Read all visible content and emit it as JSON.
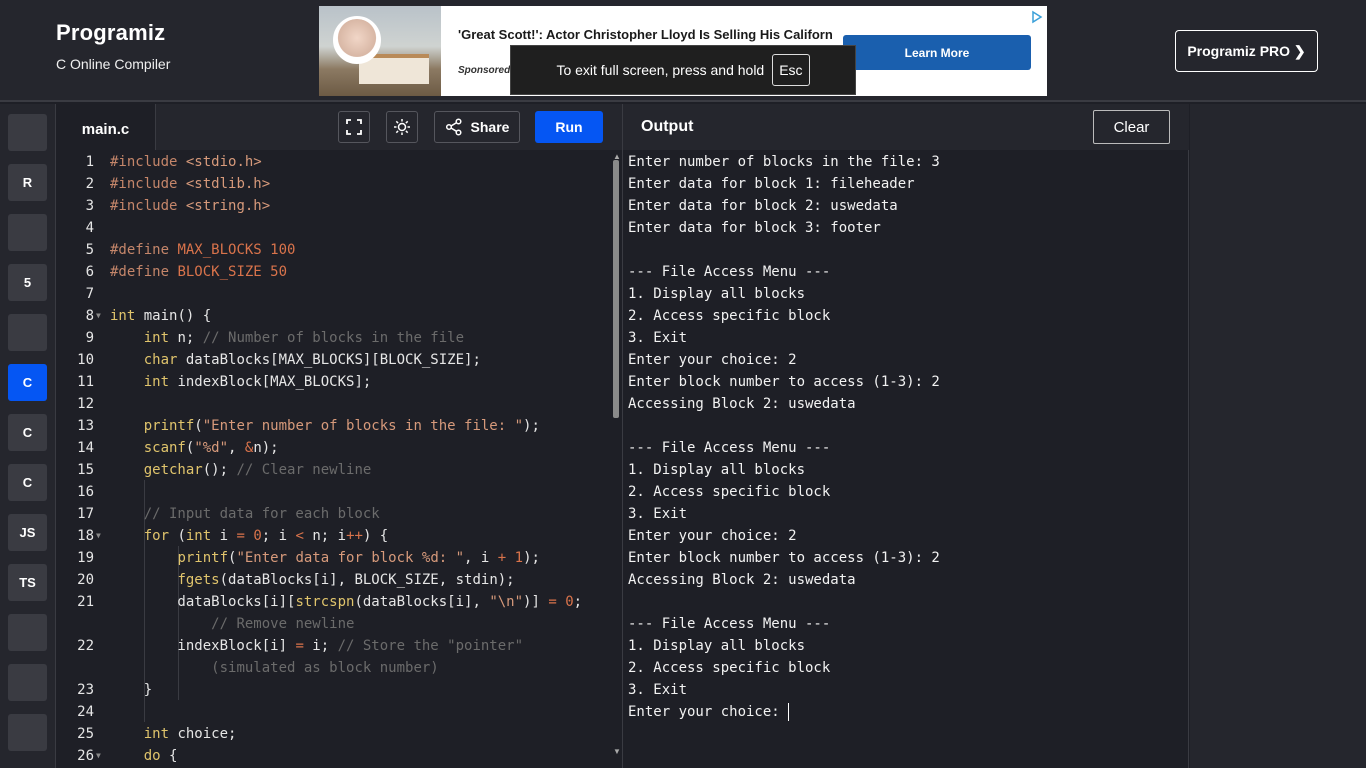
{
  "brand": {
    "name": "Programiz",
    "subtitle": "C Online Compiler",
    "pro_label": "Programiz PRO ❯"
  },
  "ad": {
    "title": "'Great Scott!': Actor Christopher Lloyd Is Selling His Californ",
    "sponsored": "Sponsored",
    "cta": "Learn More"
  },
  "fullscreen_toast": {
    "text": "To exit full screen, press and hold",
    "key": "Esc"
  },
  "languages": [
    {
      "name": "python-icon",
      "label": ""
    },
    {
      "name": "r-icon",
      "label": "R"
    },
    {
      "name": "sql-icon",
      "label": ""
    },
    {
      "name": "html-icon",
      "label": "5"
    },
    {
      "name": "java-icon",
      "label": ""
    },
    {
      "name": "c-icon",
      "label": "C"
    },
    {
      "name": "cpp-icon",
      "label": "C"
    },
    {
      "name": "csharp-icon",
      "label": "C"
    },
    {
      "name": "js-icon",
      "label": "JS"
    },
    {
      "name": "ts-icon",
      "label": "TS"
    },
    {
      "name": "go-icon",
      "label": ""
    },
    {
      "name": "php-icon",
      "label": ""
    },
    {
      "name": "swift-icon",
      "label": ""
    }
  ],
  "editor": {
    "tab": "main.c",
    "share_label": "Share",
    "run_label": "Run",
    "lines": [
      {
        "n": "1",
        "html": "<span class=\"pp\">#include</span> <span class=\"str\">&lt;stdio.h&gt;</span>"
      },
      {
        "n": "2",
        "html": "<span class=\"pp\">#include</span> <span class=\"str\">&lt;stdlib.h&gt;</span>"
      },
      {
        "n": "3",
        "html": "<span class=\"pp\">#include</span> <span class=\"str\">&lt;string.h&gt;</span>"
      },
      {
        "n": "4",
        "html": ""
      },
      {
        "n": "5",
        "html": "<span class=\"pp\">#define</span> <span class=\"num\">MAX_BLOCKS 100</span>"
      },
      {
        "n": "6",
        "html": "<span class=\"pp\">#define</span> <span class=\"num\">BLOCK_SIZE 50</span>"
      },
      {
        "n": "7",
        "html": ""
      },
      {
        "n": "8",
        "fold": true,
        "html": "<span class=\"kw\">int</span> main() {"
      },
      {
        "n": "9",
        "html": "    <span class=\"kw\">int</span> n; <span class=\"com\">// Number of blocks in the file</span>"
      },
      {
        "n": "10",
        "html": "    <span class=\"kw\">char</span> dataBlocks[MAX_BLOCKS][BLOCK_SIZE];"
      },
      {
        "n": "11",
        "html": "    <span class=\"kw\">int</span> indexBlock[MAX_BLOCKS];"
      },
      {
        "n": "12",
        "html": ""
      },
      {
        "n": "13",
        "html": "    <span class=\"fn\">printf</span>(<span class=\"str\">\"Enter number of blocks in the file: \"</span>);"
      },
      {
        "n": "14",
        "html": "    <span class=\"fn\">scanf</span>(<span class=\"str\">\"%d\"</span>, <span class=\"num\">&amp;</span>n);"
      },
      {
        "n": "15",
        "html": "    <span class=\"fn\">getchar</span>(); <span class=\"com\">// Clear newline</span>"
      },
      {
        "n": "16",
        "html": ""
      },
      {
        "n": "17",
        "html": "    <span class=\"com\">// Input data for each block</span>"
      },
      {
        "n": "18",
        "fold": true,
        "html": "    <span class=\"kw\">for</span> (<span class=\"kw\">int</span> i <span class=\"num\">=</span> <span class=\"num\">0</span>; i <span class=\"num\">&lt;</span> n; i<span class=\"num\">++</span>) {"
      },
      {
        "n": "19",
        "html": "        <span class=\"fn\">printf</span>(<span class=\"str\">\"Enter data for block %d: \"</span>, i <span class=\"num\">+</span> <span class=\"num\">1</span>);"
      },
      {
        "n": "20",
        "html": "        <span class=\"fn\">fgets</span>(dataBlocks[i], BLOCK_SIZE, stdin);"
      },
      {
        "n": "21",
        "html": "        dataBlocks[i][<span class=\"fn\">strcspn</span>(dataBlocks[i], <span class=\"str\">\"\\n\"</span>)] <span class=\"num\">=</span> <span class=\"num\">0</span>;"
      },
      {
        "n": "",
        "html": "            <span class=\"com\">// Remove newline</span>"
      },
      {
        "n": "22",
        "html": "        indexBlock[i] <span class=\"num\">=</span> i; <span class=\"com\">// Store the \"pointer\"</span>"
      },
      {
        "n": "",
        "html": "            <span class=\"com\">(simulated as block number)</span>"
      },
      {
        "n": "23",
        "html": "    }"
      },
      {
        "n": "24",
        "html": ""
      },
      {
        "n": "25",
        "html": "    <span class=\"kw\">int</span> choice;"
      },
      {
        "n": "26",
        "fold": true,
        "html": "    <span class=\"kw\">do</span> {"
      }
    ]
  },
  "output": {
    "title": "Output",
    "clear_label": "Clear",
    "lines": [
      "Enter number of blocks in the file: 3",
      "Enter data for block 1: fileheader",
      "Enter data for block 2: uswedata",
      "Enter data for block 3: footer",
      "",
      "--- File Access Menu ---",
      "1. Display all blocks",
      "2. Access specific block",
      "3. Exit",
      "Enter your choice: 2",
      "Enter block number to access (1-3): 2",
      "Accessing Block 2: uswedata",
      "",
      "--- File Access Menu ---",
      "1. Display all blocks",
      "2. Access specific block",
      "3. Exit",
      "Enter your choice: 2",
      "Enter block number to access (1-3): 2",
      "Accessing Block 2: uswedata",
      "",
      "--- File Access Menu ---",
      "1. Display all blocks",
      "2. Access specific block",
      "3. Exit",
      "Enter your choice: "
    ]
  }
}
